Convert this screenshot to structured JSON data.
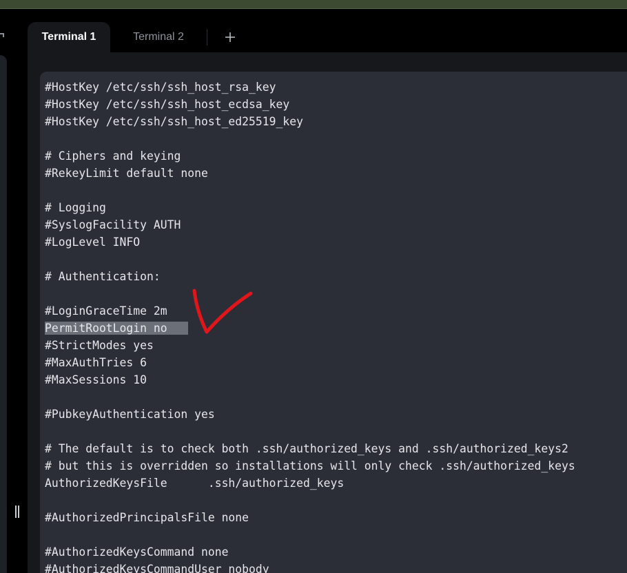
{
  "tabs": [
    {
      "label": "Terminal 1",
      "active": true
    },
    {
      "label": "Terminal 2",
      "active": false
    }
  ],
  "add_tab_label": "+",
  "terminal": {
    "lines": [
      "#HostKey /etc/ssh/ssh_host_rsa_key",
      "#HostKey /etc/ssh/ssh_host_ecdsa_key",
      "#HostKey /etc/ssh/ssh_host_ed25519_key",
      "",
      "# Ciphers and keying",
      "#RekeyLimit default none",
      "",
      "# Logging",
      "#SyslogFacility AUTH",
      "#LogLevel INFO",
      "",
      "# Authentication:",
      "",
      "#LoginGraceTime 2m",
      "PermitRootLogin no",
      "#StrictModes yes",
      "#MaxAuthTries 6",
      "#MaxSessions 10",
      "",
      "#PubkeyAuthentication yes",
      "",
      "# The default is to check both .ssh/authorized_keys and .ssh/authorized_keys2",
      "# but this is overridden so installations will only check .ssh/authorized_keys",
      "AuthorizedKeysFile      .ssh/authorized_keys",
      "",
      "#AuthorizedPrincipalsFile none",
      "",
      "#AuthorizedKeysCommand none",
      "#AuthorizedKeysCommandUser nobody"
    ],
    "selected_line": "PermitRootLogin no"
  },
  "colors": {
    "top_strip": "#3c4a32",
    "terminal_bg": "#2b2e37",
    "selection": "#6b6f78",
    "annotation": "#e0161b"
  }
}
